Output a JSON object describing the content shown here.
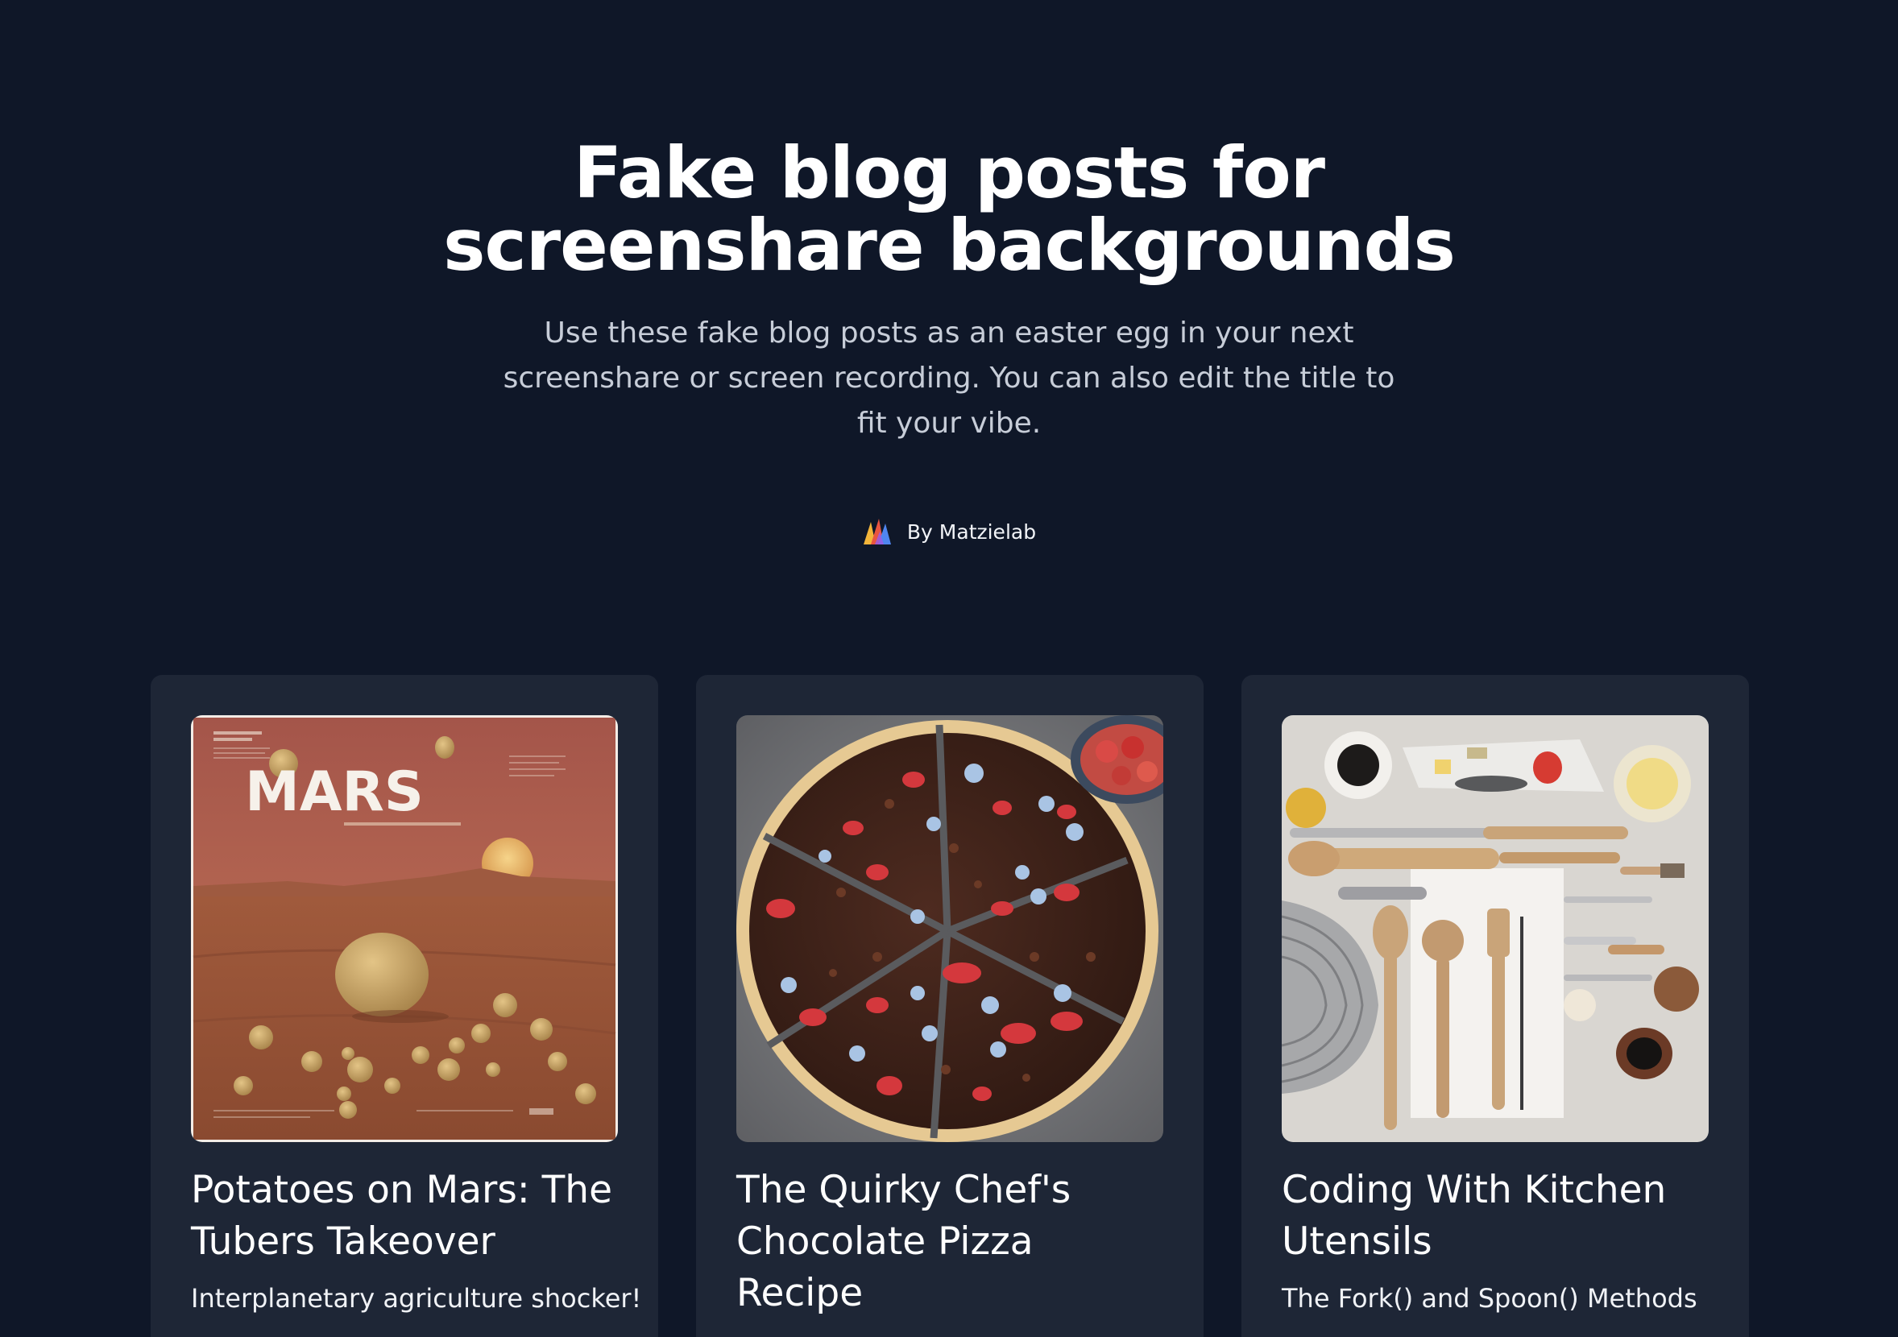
{
  "hero": {
    "title": "Fake blog posts for screenshare backgrounds",
    "description": "Use these fake blog posts as an easter egg in your next screenshare or screen recording. You can also edit the title to fit your vibe."
  },
  "byline": {
    "text": "By Matzielab",
    "logo_icon": "matzielab-logo-icon"
  },
  "posts": [
    {
      "title": "Potatoes on Mars: The Tubers Takeover",
      "subtitle": "Interplanetary agriculture shocker!",
      "image_text": "MARS"
    },
    {
      "title": "The Quirky Chef's Chocolate Pizza Recipe",
      "subtitle": ""
    },
    {
      "title": "Coding With Kitchen Utensils",
      "subtitle": "The Fork() and Spoon() Methods"
    }
  ],
  "colors": {
    "background": "#0f1728",
    "card": "#1e2636",
    "subtitle_text": "#c7cdd8"
  }
}
